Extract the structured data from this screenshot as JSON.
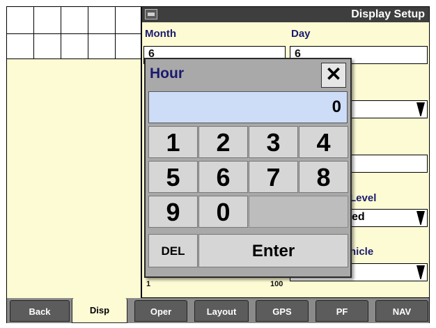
{
  "title": "Display Setup",
  "fields": {
    "month": {
      "label": "Month",
      "value": "6"
    },
    "day": {
      "label": "Day",
      "value": "6"
    },
    "level_label_partial": "Level",
    "level_value_partial": "ed",
    "vehicle_label_partial": "hicle",
    "slider_min": "1",
    "slider_max": "100"
  },
  "dialog": {
    "title": "Hour",
    "close": "✕",
    "value": "0",
    "keys": [
      "1",
      "2",
      "3",
      "4",
      "5",
      "6",
      "7",
      "8",
      "9",
      "0"
    ],
    "del": "DEL",
    "enter": "Enter"
  },
  "nav": {
    "tabs": [
      "Back",
      "Disp",
      "Oper",
      "Layout",
      "GPS",
      "PF",
      "NAV"
    ],
    "active": "Disp"
  },
  "icons": {
    "title": "display-icon",
    "dropdown": "triangle-down-icon",
    "close": "close-icon"
  },
  "colors": {
    "panel_bg": "#fdfbd4",
    "title_bg": "#3e3e3e",
    "dialog_bg": "#a9a9a9",
    "value_bg": "#cddcf7",
    "tab_bg": "#5c5c5c",
    "label_text": "#1a1a6e"
  }
}
